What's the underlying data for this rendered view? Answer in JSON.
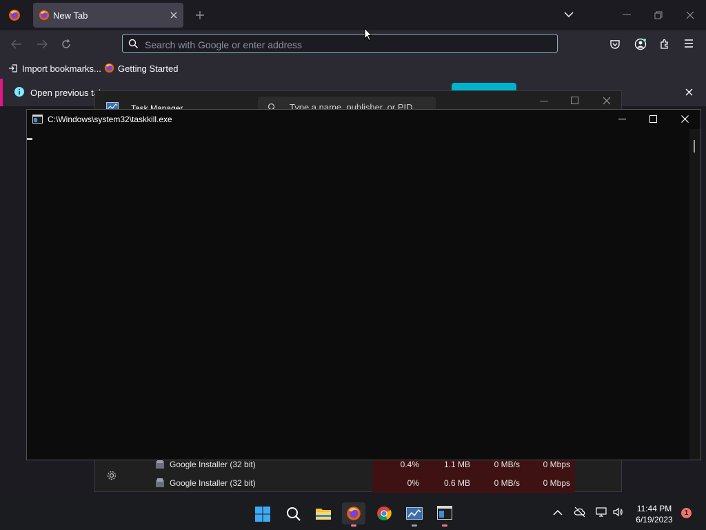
{
  "firefox": {
    "tab_title": "New Tab",
    "url_placeholder": "Search with Google or enter address",
    "bookmarks": [
      {
        "label": "Import bookmarks...",
        "icon": "import-icon"
      },
      {
        "label": "Getting Started",
        "icon": "firefox-icon"
      }
    ],
    "infobar_text": "Open previous tal"
  },
  "task_manager": {
    "title": "Task Manager",
    "search_placeholder": "Type a name, publisher, or PID",
    "rows": [
      {
        "name": "Google Installer (32 bit)",
        "cpu": "0.4%",
        "memory": "1.1 MB",
        "disk": "0 MB/s",
        "network": "0 Mbps"
      },
      {
        "name": "Google Installer (32 bit)",
        "cpu": "0%",
        "memory": "0.6 MB",
        "disk": "0 MB/s",
        "network": "0 Mbps"
      }
    ]
  },
  "console": {
    "title": "C:\\Windows\\system32\\taskkill.exe"
  },
  "taskbar": {
    "time": "11:44 PM",
    "date": "6/19/2023",
    "notification_count": "1"
  },
  "colors": {
    "accent": "#00b3cc",
    "infobar_stripe": "#e31587",
    "console_bg": "#0c0c0c"
  }
}
